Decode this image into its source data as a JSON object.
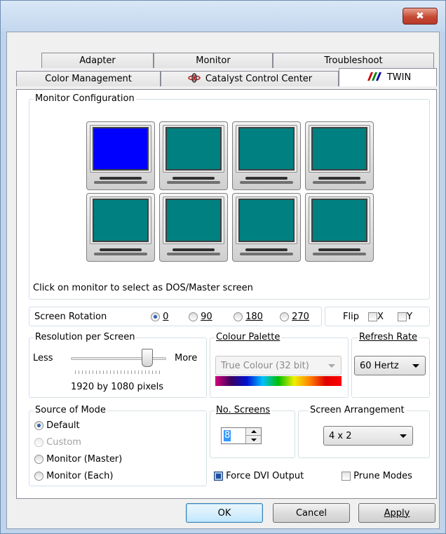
{
  "window": {
    "close_glyph": "✖"
  },
  "tabs_row1": [
    {
      "label": "Adapter"
    },
    {
      "label": "Monitor"
    },
    {
      "label": "Troubleshoot"
    }
  ],
  "tabs_row2": [
    {
      "label": "Color Management"
    },
    {
      "label": "Catalyst Control Center",
      "icon": "ati-logo-icon"
    },
    {
      "label": "TWIN",
      "icon": "twin-logo-icon",
      "active": true
    }
  ],
  "monitor_config": {
    "title": "Monitor Configuration",
    "selected_index": 0,
    "count": 8,
    "hint": "Click on monitor to select as DOS/Master screen",
    "colors": {
      "selected": "#0000ff",
      "normal": "#008080"
    }
  },
  "rotation": {
    "label": "Screen Rotation",
    "options": [
      "0",
      "90",
      "180",
      "270"
    ],
    "selected": "0",
    "flip_label": "Flip",
    "flip_x": "X",
    "flip_y": "Y"
  },
  "resolution": {
    "title": "Resolution per Screen",
    "less": "Less",
    "more": "More",
    "value_text": "1920 by 1080 pixels",
    "slider_level": 0.8
  },
  "colour_palette": {
    "title": "Colour Palette",
    "value": "True Colour (32 bit)"
  },
  "refresh_rate": {
    "title": "Refresh Rate",
    "value": "60 Hertz"
  },
  "source_of_mode": {
    "title": "Source of Mode",
    "options": [
      "Default",
      "Custom",
      "Monitor (Master)",
      "Monitor (Each)"
    ],
    "selected": "Default",
    "disabled": [
      "Custom"
    ]
  },
  "no_screens": {
    "title": "No. Screens",
    "value": "8"
  },
  "screen_arrangement": {
    "title": "Screen Arrangement",
    "value": "4 x 2"
  },
  "options": {
    "force_dvi": "Force DVI Output",
    "force_dvi_checked": true,
    "prune_modes": "Prune Modes",
    "prune_modes_checked": false
  },
  "buttons": {
    "ok": "OK",
    "cancel": "Cancel",
    "apply": "Apply"
  }
}
